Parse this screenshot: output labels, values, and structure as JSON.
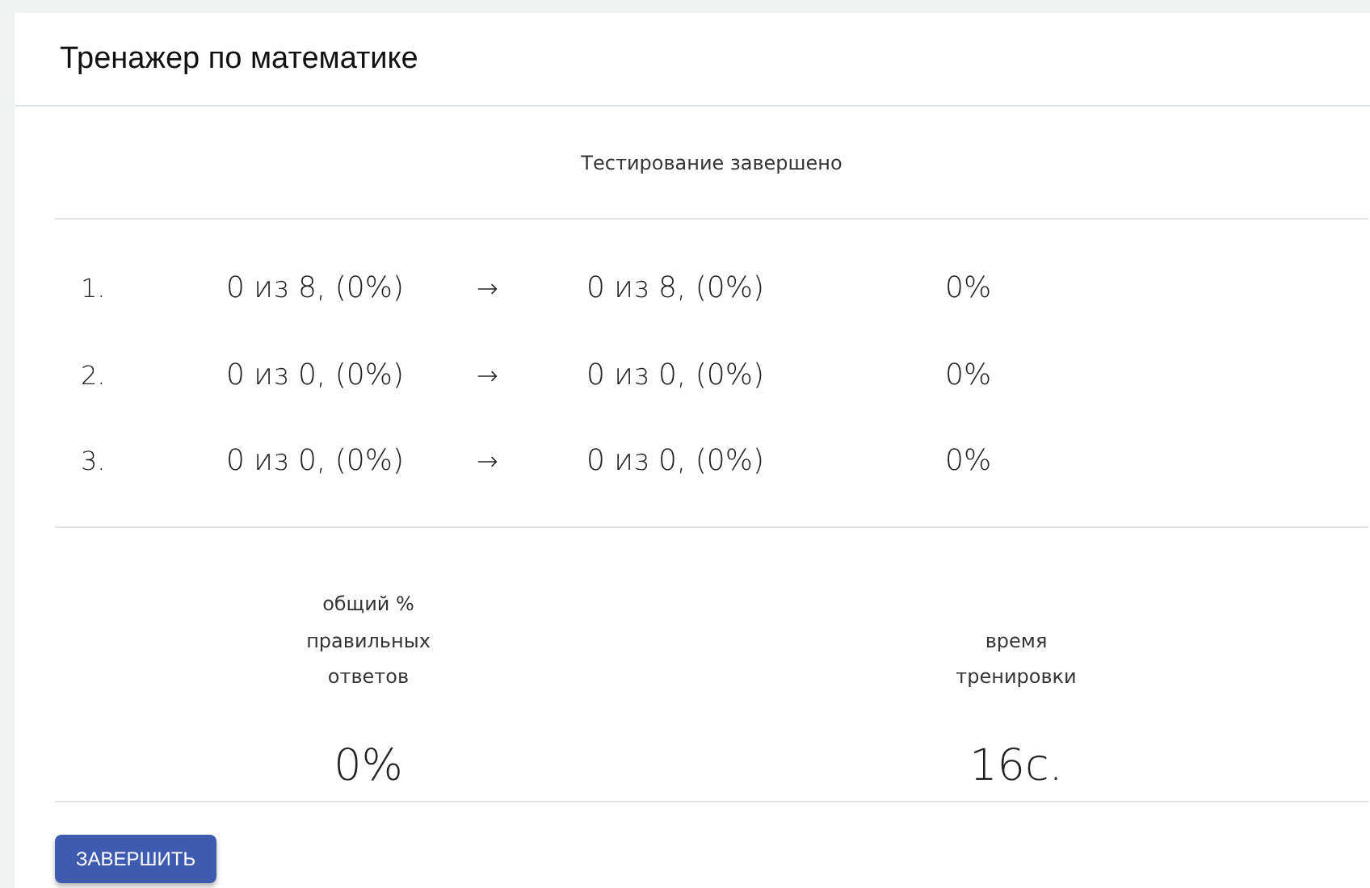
{
  "title": "Тренажер по математике",
  "status": "Тестирование завершено",
  "rows": [
    {
      "number": "1.",
      "before": "0 из 8, (0%)",
      "arrow": "→",
      "after": "0 из 8, (0%)",
      "percent": "0%"
    },
    {
      "number": "2.",
      "before": "0 из 0, (0%)",
      "arrow": "→",
      "after": "0 из 0, (0%)",
      "percent": "0%"
    },
    {
      "number": "3.",
      "before": "0 из 0, (0%)",
      "arrow": "→",
      "after": "0 из 0, (0%)",
      "percent": "0%"
    }
  ],
  "summary": [
    {
      "label": "общий % правильных ответов",
      "value": "0%"
    },
    {
      "label": "время тренировки",
      "value": "16с."
    }
  ],
  "button": "ЗАВЕРШИТЬ"
}
